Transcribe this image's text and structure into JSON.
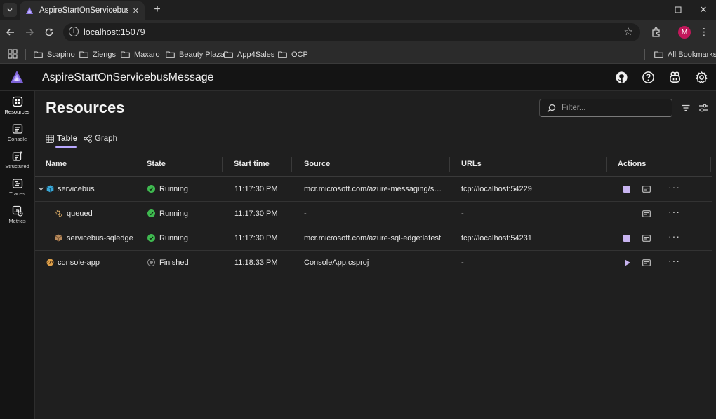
{
  "browser": {
    "tab_title": "AspireStartOnServicebusMessage",
    "url": "localhost:15079",
    "avatar_initial": "M",
    "bookmarks": [
      "Scapino",
      "Ziengs",
      "Maxaro",
      "Beauty Plaza",
      "App4Sales",
      "OCP"
    ],
    "all_bookmarks": "All Bookmarks"
  },
  "app": {
    "title": "AspireStartOnServicebusMessage"
  },
  "sidebar": {
    "items": [
      {
        "label": "Resources",
        "icon": "resources-icon"
      },
      {
        "label": "Console",
        "icon": "console-icon"
      },
      {
        "label": "Structured",
        "icon": "structured-icon"
      },
      {
        "label": "Traces",
        "icon": "traces-icon"
      },
      {
        "label": "Metrics",
        "icon": "metrics-icon"
      }
    ]
  },
  "main": {
    "title": "Resources",
    "filter_placeholder": "Filter...",
    "tabs": [
      {
        "label": "Table"
      },
      {
        "label": "Graph"
      }
    ],
    "columns": [
      "Name",
      "State",
      "Start time",
      "Source",
      "URLs",
      "Actions"
    ],
    "rows": [
      {
        "name": "servicebus",
        "state": "Running",
        "start": "11:17:30 PM",
        "source": "mcr.microsoft.com/azure-messaging/servicebus-emulator:latest",
        "urls": "tcp://localhost:54229",
        "action": "stop"
      },
      {
        "name": "queued",
        "state": "Running",
        "start": "11:17:30 PM",
        "source": "-",
        "urls": "-",
        "action": "none"
      },
      {
        "name": "servicebus-sqledge",
        "state": "Running",
        "start": "11:17:30 PM",
        "source": "mcr.microsoft.com/azure-sql-edge:latest",
        "urls": "tcp://localhost:54231",
        "action": "stop"
      },
      {
        "name": "console-app",
        "state": "Finished",
        "start": "11:18:33 PM",
        "source": "ConsoleApp.csproj",
        "urls": "-",
        "action": "start"
      }
    ]
  },
  "colors": {
    "accent": "#b9a8ff",
    "running": "#3fb950",
    "stop": "#c8b4f0"
  }
}
